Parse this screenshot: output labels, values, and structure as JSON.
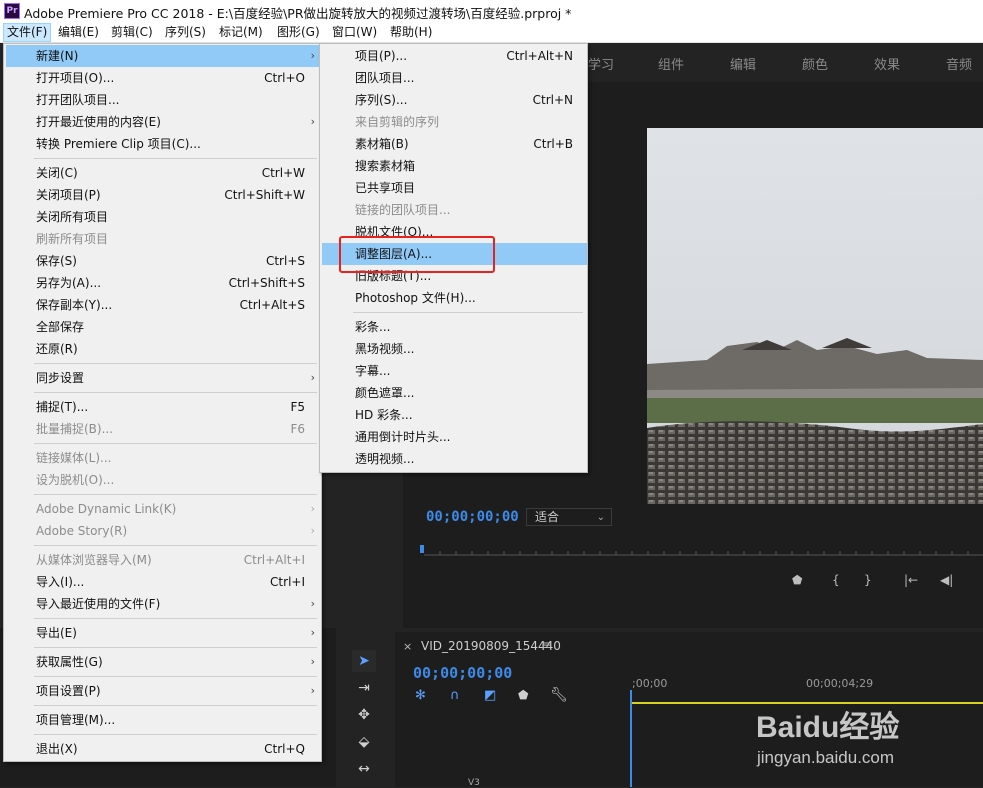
{
  "window": {
    "app_icon": "Pr",
    "title": "Adobe Premiere Pro CC 2018 - E:\\百度经验\\PR做出旋转放大的视频过渡转场\\百度经验.prproj *"
  },
  "menubar": {
    "items": [
      {
        "label": "文件(F)"
      },
      {
        "label": "编辑(E)"
      },
      {
        "label": "剪辑(C)"
      },
      {
        "label": "序列(S)"
      },
      {
        "label": "标记(M)"
      },
      {
        "label": "图形(G)"
      },
      {
        "label": "窗口(W)"
      },
      {
        "label": "帮助(H)"
      }
    ]
  },
  "workspace_tabs": [
    "学习",
    "组件",
    "编辑",
    "颜色",
    "效果",
    "音频"
  ],
  "file_menu": {
    "items": [
      {
        "label": "新建(N)",
        "shortcut": "",
        "submenu": true
      },
      {
        "label": "打开项目(O)...",
        "shortcut": "Ctrl+O"
      },
      {
        "label": "打开团队项目..."
      },
      {
        "label": "打开最近使用的内容(E)",
        "submenu": true
      },
      {
        "label": "转换 Premiere Clip 项目(C)..."
      },
      {
        "label": "关闭(C)",
        "shortcut": "Ctrl+W"
      },
      {
        "label": "关闭项目(P)",
        "shortcut": "Ctrl+Shift+W"
      },
      {
        "label": "关闭所有项目"
      },
      {
        "label": "刷新所有项目"
      },
      {
        "label": "保存(S)",
        "shortcut": "Ctrl+S"
      },
      {
        "label": "另存为(A)...",
        "shortcut": "Ctrl+Shift+S"
      },
      {
        "label": "保存副本(Y)...",
        "shortcut": "Ctrl+Alt+S"
      },
      {
        "label": "全部保存"
      },
      {
        "label": "还原(R)"
      },
      {
        "label": "同步设置",
        "submenu": true
      },
      {
        "label": "捕捉(T)...",
        "shortcut": "F5"
      },
      {
        "label": "批量捕捉(B)...",
        "shortcut": "F6"
      },
      {
        "label": "链接媒体(L)..."
      },
      {
        "label": "设为脱机(O)..."
      },
      {
        "label": "Adobe Dynamic Link(K)",
        "submenu": true
      },
      {
        "label": "Adobe Story(R)",
        "submenu": true
      },
      {
        "label": "从媒体浏览器导入(M)",
        "shortcut": "Ctrl+Alt+I"
      },
      {
        "label": "导入(I)...",
        "shortcut": "Ctrl+I"
      },
      {
        "label": "导入最近使用的文件(F)",
        "submenu": true
      },
      {
        "label": "导出(E)",
        "submenu": true
      },
      {
        "label": "获取属性(G)",
        "submenu": true
      },
      {
        "label": "项目设置(P)",
        "submenu": true
      },
      {
        "label": "项目管理(M)..."
      },
      {
        "label": "退出(X)",
        "shortcut": "Ctrl+Q"
      }
    ]
  },
  "new_submenu": {
    "items": [
      {
        "label": "项目(P)...",
        "shortcut": "Ctrl+Alt+N"
      },
      {
        "label": "团队项目..."
      },
      {
        "label": "序列(S)...",
        "shortcut": "Ctrl+N"
      },
      {
        "label": "来自剪辑的序列"
      },
      {
        "label": "素材箱(B)",
        "shortcut": "Ctrl+B"
      },
      {
        "label": "搜索素材箱"
      },
      {
        "label": "已共享项目"
      },
      {
        "label": "链接的团队项目..."
      },
      {
        "label": "脱机文件(O)..."
      },
      {
        "label": "调整图层(A)..."
      },
      {
        "label": "旧版标题(T)..."
      },
      {
        "label": "Photoshop 文件(H)..."
      },
      {
        "label": "彩条..."
      },
      {
        "label": "黑场视频..."
      },
      {
        "label": "字幕..."
      },
      {
        "label": "颜色遮罩..."
      },
      {
        "label": "HD 彩条..."
      },
      {
        "label": "通用倒计时片头..."
      },
      {
        "label": "透明视频..."
      }
    ]
  },
  "program_monitor": {
    "timecode": "00;00;00;00",
    "fit": "适合"
  },
  "timeline": {
    "sequence_name": "VID_20190809_154440",
    "timecode": "00;00;00;00",
    "ruler_start": ";00;00",
    "ruler_mid": "00;00;04;29",
    "track": "V3"
  },
  "watermark": {
    "logo": "Baidu经验",
    "url": "jingyan.baidu.com"
  },
  "colors": {
    "menu_highlight": "#91c9f7",
    "timecode_blue": "#3d8ae8",
    "annotation_red": "#e8231f"
  }
}
